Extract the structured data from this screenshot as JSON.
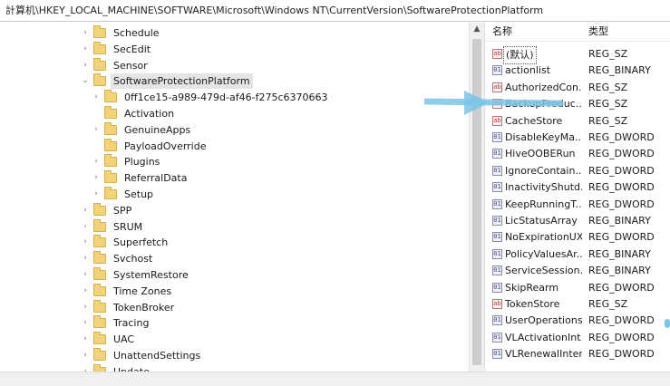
{
  "address": "計算机\\HKEY_LOCAL_MACHINE\\SOFTWARE\\Microsoft\\Windows NT\\CurrentVersion\\SoftwareProtectionPlatform",
  "tree": [
    {
      "label": "Schedule",
      "expander": "›",
      "indent": 0
    },
    {
      "label": "SecEdit",
      "expander": "›",
      "indent": 0
    },
    {
      "label": "Sensor",
      "expander": "›",
      "indent": 0
    },
    {
      "label": "SoftwareProtectionPlatform",
      "expander": "⌄",
      "indent": 0,
      "selected": true
    },
    {
      "label": "0ff1ce15-a989-479d-af46-f275c6370663",
      "expander": "›",
      "indent": 1
    },
    {
      "label": "Activation",
      "expander": "",
      "indent": 1
    },
    {
      "label": "GenuineApps",
      "expander": "›",
      "indent": 1
    },
    {
      "label": "PayloadOverride",
      "expander": "",
      "indent": 1
    },
    {
      "label": "Plugins",
      "expander": "›",
      "indent": 1
    },
    {
      "label": "ReferralData",
      "expander": "›",
      "indent": 1
    },
    {
      "label": "Setup",
      "expander": "›",
      "indent": 1
    },
    {
      "label": "SPP",
      "expander": "›",
      "indent": 0
    },
    {
      "label": "SRUM",
      "expander": "›",
      "indent": 0
    },
    {
      "label": "Superfetch",
      "expander": "›",
      "indent": 0
    },
    {
      "label": "Svchost",
      "expander": "›",
      "indent": 0
    },
    {
      "label": "SystemRestore",
      "expander": "›",
      "indent": 0
    },
    {
      "label": "Time Zones",
      "expander": "›",
      "indent": 0
    },
    {
      "label": "TokenBroker",
      "expander": "›",
      "indent": 0
    },
    {
      "label": "Tracing",
      "expander": "›",
      "indent": 0
    },
    {
      "label": "UAC",
      "expander": "›",
      "indent": 0
    },
    {
      "label": "UnattendSettings",
      "expander": "›",
      "indent": 0
    },
    {
      "label": "Update",
      "expander": "›",
      "indent": 0
    }
  ],
  "values_header": {
    "name": "名称",
    "type": "类型"
  },
  "values": [
    {
      "name": "(默认)",
      "type": "REG_SZ",
      "icon": "string-value-icon",
      "glyph": "ab"
    },
    {
      "name": "actionlist",
      "type": "REG_BINARY",
      "icon": "binary-value-icon",
      "glyph": "01"
    },
    {
      "name": "AuthorizedCon...",
      "type": "REG_SZ",
      "icon": "string-value-icon",
      "glyph": "ab"
    },
    {
      "name": "BackupProduc...",
      "type": "REG_SZ",
      "icon": "string-value-icon",
      "glyph": "ab"
    },
    {
      "name": "CacheStore",
      "type": "REG_SZ",
      "icon": "string-value-icon",
      "glyph": "ab"
    },
    {
      "name": "DisableKeyMa...",
      "type": "REG_DWORD",
      "icon": "binary-value-icon",
      "glyph": "01"
    },
    {
      "name": "HiveOOBERun",
      "type": "REG_DWORD",
      "icon": "binary-value-icon",
      "glyph": "01"
    },
    {
      "name": "IgnoreContain...",
      "type": "REG_DWORD",
      "icon": "binary-value-icon",
      "glyph": "01"
    },
    {
      "name": "InactivityShutd...",
      "type": "REG_DWORD",
      "icon": "binary-value-icon",
      "glyph": "01"
    },
    {
      "name": "KeepRunningT...",
      "type": "REG_DWORD",
      "icon": "binary-value-icon",
      "glyph": "01"
    },
    {
      "name": "LicStatusArray",
      "type": "REG_BINARY",
      "icon": "binary-value-icon",
      "glyph": "01"
    },
    {
      "name": "NoExpirationUX",
      "type": "REG_DWORD",
      "icon": "binary-value-icon",
      "glyph": "01"
    },
    {
      "name": "PolicyValuesAr...",
      "type": "REG_BINARY",
      "icon": "binary-value-icon",
      "glyph": "01"
    },
    {
      "name": "ServiceSession...",
      "type": "REG_BINARY",
      "icon": "binary-value-icon",
      "glyph": "01"
    },
    {
      "name": "SkipRearm",
      "type": "REG_DWORD",
      "icon": "binary-value-icon",
      "glyph": "01"
    },
    {
      "name": "TokenStore",
      "type": "REG_SZ",
      "icon": "string-value-icon",
      "glyph": "ab"
    },
    {
      "name": "UserOperations",
      "type": "REG_DWORD",
      "icon": "binary-value-icon",
      "glyph": "01"
    },
    {
      "name": "VLActivationInt...",
      "type": "REG_DWORD",
      "icon": "binary-value-icon",
      "glyph": "01"
    },
    {
      "name": "VLRenewalInter...",
      "type": "REG_DWORD",
      "icon": "binary-value-icon",
      "glyph": "01"
    }
  ],
  "colors": {
    "annotation_arrow": "#7cc4e8",
    "folder": "#f2d27a"
  }
}
